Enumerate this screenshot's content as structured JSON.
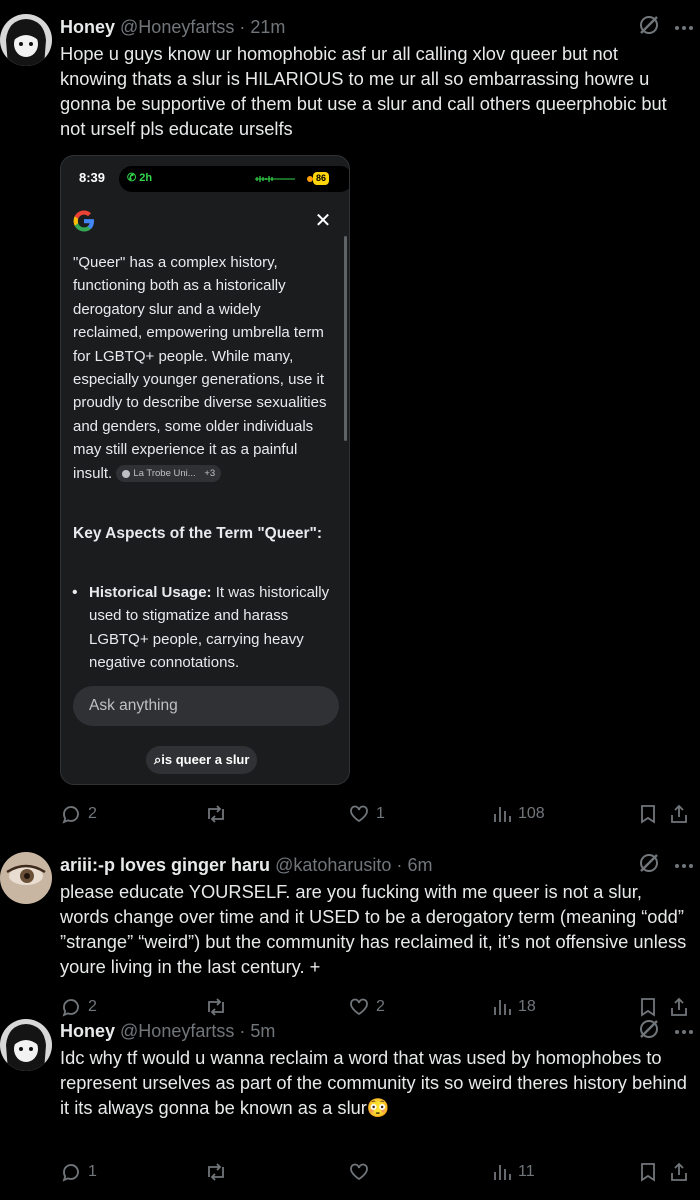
{
  "posts": [
    {
      "name": "Honey",
      "handle": "@Honeyfartss",
      "separator": "·",
      "time": "21m",
      "text": "Hope u guys know ur homophobic asf ur all calling xlov queer but not knowing thats a slur is HILARIOUS to me ur all so embarrassing howre u gonna be supportive of them but use a slur and call others queerphobic but not urself pls educate urselfs",
      "replies": "2",
      "reposts": "",
      "likes": "1",
      "views": "108"
    },
    {
      "name": "ariii:-p loves ginger haru",
      "handle": "@katoharusito",
      "separator": "·",
      "time": "6m",
      "text": "please educate YOURSELF. are you fucking with me queer is not a slur, words change over time and it USED to be a derogatory term (meaning “odd” ”strange” “weird”) but the community has reclaimed it, it’s not offensive unless youre living in the last century. +",
      "replies": "2",
      "reposts": "",
      "likes": "2",
      "views": "18"
    },
    {
      "name": "Honey",
      "handle": "@Honeyfartss",
      "separator": "·",
      "time": "5m",
      "text": "Idc why tf would u wanna reclaim a word that was used by homophobes to represent urselves as part of the community its so weird theres history behind it its always gonna be known as a slur😳",
      "replies": "1",
      "reposts": "",
      "likes": "",
      "views": "11"
    }
  ],
  "screenshot": {
    "status_time": "8:39",
    "call_duration": "2h",
    "battery": "86",
    "answer": "\"Queer\" has a complex history, functioning both as a historically derogatory slur and a widely reclaimed, empowering umbrella term for LGBTQ+ people. While many, especially younger generations, use it proudly to describe diverse sexualities and genders, some older individuals may still experience it as a painful insult.",
    "source_chip": "La Trobe Uni...",
    "source_more": "+3",
    "heading": "Key Aspects of the Term \"Queer\":",
    "bullet_title": "Historical Usage:",
    "bullet_text": "It was historically used to stigmatize and harass LGBTQ+ people, carrying heavy negative connotations.",
    "ask_placeholder": "Ask anything",
    "query": "is queer a slur"
  },
  "icons": {
    "reply": "speech-bubble-icon",
    "repost": "repost-arrows-icon",
    "like": "heart-icon",
    "views": "bar-chart-icon",
    "bookmark": "bookmark-icon",
    "share": "share-icon",
    "grok": "grok-slash-icon",
    "more": "more-dots-icon"
  },
  "colors": {
    "background": "#000000",
    "text": "#e7e9ea",
    "muted": "#71767b"
  }
}
